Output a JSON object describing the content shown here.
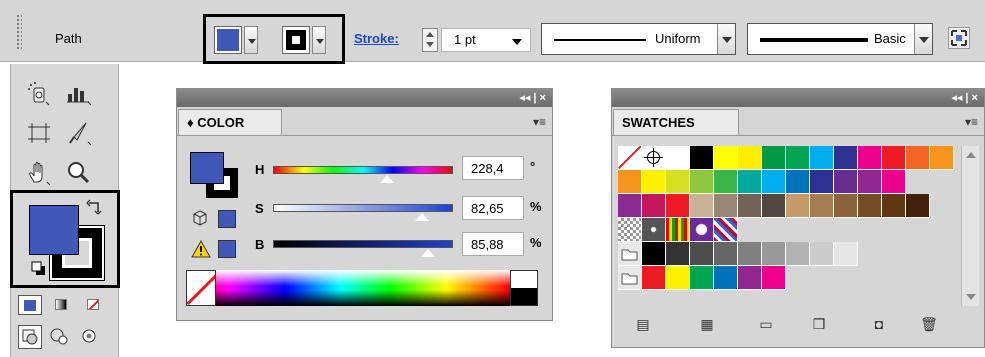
{
  "controlbar": {
    "mode_label": "Path",
    "fill_color": "#4059b8",
    "stroke_color": "#000000",
    "stroke_link": "Stroke:",
    "stroke_weight": "1 pt",
    "profile_label": "Uniform",
    "brush_label": "Basic"
  },
  "tools": {
    "items": [
      "symbol-sprayer-icon",
      "graph-icon",
      "artboard-icon",
      "slice-icon",
      "hand-icon",
      "zoom-icon"
    ],
    "fill_color": "#4059b8",
    "stroke_color": "#000000"
  },
  "color_panel": {
    "tab_label": "COLOR",
    "tab_prefix": "♦",
    "sliders": [
      {
        "label": "H",
        "value": "228,4",
        "unit": "°",
        "fraction": 0.634
      },
      {
        "label": "S",
        "value": "82,65",
        "unit": "%",
        "fraction": 0.8265
      },
      {
        "label": "B",
        "value": "85,88",
        "unit": "%",
        "fraction": 0.8588
      }
    ],
    "collapse_label": "◂◂ | ×"
  },
  "swatches_panel": {
    "tab_label": "SWATCHES",
    "collapse_label": "◂◂ | ×",
    "rows": [
      [
        "none",
        "reg",
        "#ffffff",
        "#000000",
        "#ffff00",
        "#ffed00",
        "#009a44",
        "#00a651",
        "#00aeef",
        "#2e3192",
        "#ec008c",
        "#ed1c24",
        "#f26522",
        "#f7941d"
      ],
      [
        "#f7941d",
        "#fff200",
        "#d7df23",
        "#8dc63f",
        "#39b54a",
        "#00a99d",
        "#00aeef",
        "#0072bc",
        "#2e3192",
        "#662d91",
        "#92278f",
        "#ec008c"
      ],
      [
        "#8b2c91",
        "#c2185b",
        "#ed1c24",
        "#c7b299",
        "#998675",
        "#736357",
        "#534741",
        "#c69c6d",
        "#a67c52",
        "#8c6239",
        "#754c24",
        "#603913",
        "#42210b"
      ],
      [
        "p1",
        "p2",
        "p3",
        "p4",
        "p5"
      ],
      [
        "folder",
        "#000000",
        "#333333",
        "#4d4d4d",
        "#666666",
        "#808080",
        "#999999",
        "#b3b3b3",
        "#cccccc",
        "#e6e6e6"
      ],
      [
        "folder",
        "#ed1c24",
        "#fff200",
        "#00a651",
        "#0072bc",
        "#92278f",
        "#ec008c"
      ]
    ]
  }
}
